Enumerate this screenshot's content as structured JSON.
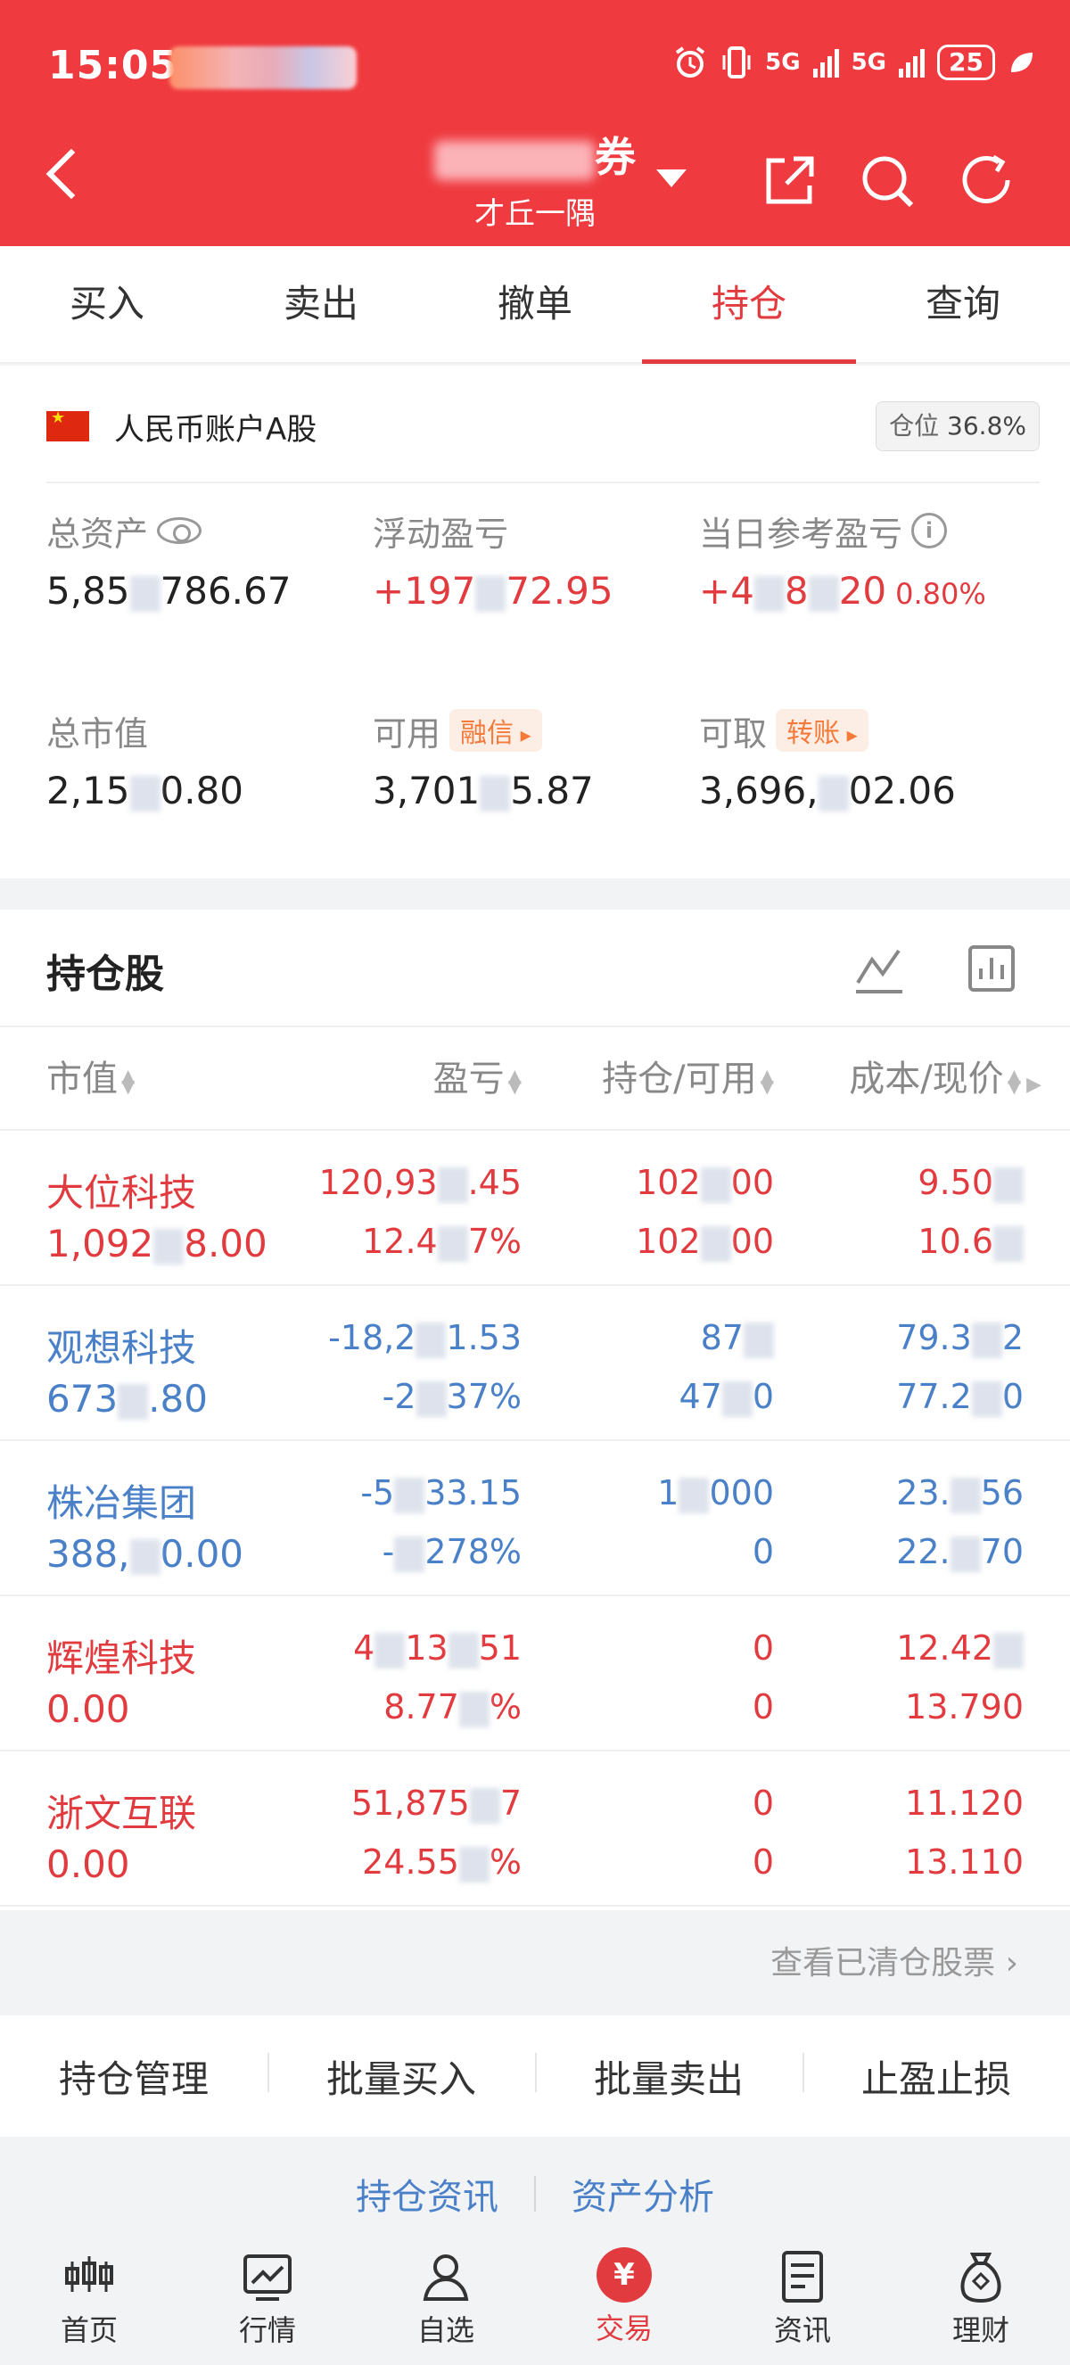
{
  "status_bar": {
    "time": "15:05",
    "network": "5G",
    "network2": "5G",
    "battery": "25"
  },
  "header": {
    "title_suffix": "券",
    "subtitle": "才丘一隅"
  },
  "tabs": [
    {
      "label": "买入"
    },
    {
      "label": "卖出"
    },
    {
      "label": "撤单"
    },
    {
      "label": "持仓"
    },
    {
      "label": "查询"
    }
  ],
  "account": {
    "name": "人民币账户A股",
    "position_label": "仓位",
    "position_value": "36.8%",
    "total_assets_label": "总资产",
    "total_assets_value": "5,85█786.67",
    "floating_pl_label": "浮动盈亏",
    "floating_pl_value": "+197█72.95",
    "daily_pl_label": "当日参考盈亏",
    "daily_pl_value": "+4█8█20",
    "daily_pl_pct": "0.80%",
    "market_value_label": "总市值",
    "market_value_value": "2,15█0.80",
    "available_label": "可用",
    "available_tag": "融信",
    "available_value": "3,701█5.87",
    "withdrawable_label": "可取",
    "withdrawable_tag": "转账",
    "withdrawable_value": "3,696,█02.06"
  },
  "holdings": {
    "title": "持仓股",
    "columns": {
      "market_value": "市值",
      "pl": "盈亏",
      "qty": "持仓/可用",
      "cost": "成本/现价"
    },
    "rows": [
      {
        "name": "大位科技",
        "mv": "1,092█8.00",
        "pl": "120,93█.45",
        "pl_pct": "12.4█7%",
        "qty": "102█00",
        "avail": "102█00",
        "cost": "9.50█",
        "price": "10.6█",
        "color": "red"
      },
      {
        "name": "观想科技",
        "mv": "673█.80",
        "pl": "-18,2█1.53",
        "pl_pct": "-2█37%",
        "qty": "87█",
        "avail": "47█0",
        "cost": "79.3█2",
        "price": "77.2█0",
        "color": "blue"
      },
      {
        "name": "株冶集团",
        "mv": "388,█0.00",
        "pl": "-5█33.15",
        "pl_pct": "-█278%",
        "qty": "1█000",
        "avail": "0",
        "cost": "23.█56",
        "price": "22.█70",
        "color": "blue"
      },
      {
        "name": "辉煌科技",
        "mv": "0.00",
        "pl": "4█13█51",
        "pl_pct": "8.77█%",
        "qty": "0",
        "avail": "0",
        "cost": "12.42█",
        "price": "13.790",
        "color": "red"
      },
      {
        "name": "浙文互联",
        "mv": "0.00",
        "pl": "51,875█7",
        "pl_pct": "24.55█%",
        "qty": "0",
        "avail": "0",
        "cost": "11.120",
        "price": "13.110",
        "color": "red"
      }
    ],
    "cleared_link": "查看已清仓股票"
  },
  "actions": [
    {
      "label": "持仓管理"
    },
    {
      "label": "批量买入"
    },
    {
      "label": "批量卖出"
    },
    {
      "label": "止盈止损"
    }
  ],
  "links": {
    "holding_news": "持仓资讯",
    "asset_analysis": "资产分析"
  },
  "bottom_nav": [
    {
      "label": "首页",
      "icon": "candlestick-icon"
    },
    {
      "label": "行情",
      "icon": "chart-icon"
    },
    {
      "label": "自选",
      "icon": "user-icon"
    },
    {
      "label": "交易",
      "icon": "yuan-icon"
    },
    {
      "label": "资讯",
      "icon": "document-icon"
    },
    {
      "label": "理财",
      "icon": "money-bag-icon"
    }
  ],
  "colors": {
    "brand_red": "#ef3a3f",
    "gain": "#e23b3f",
    "loss": "#4a80c8"
  }
}
